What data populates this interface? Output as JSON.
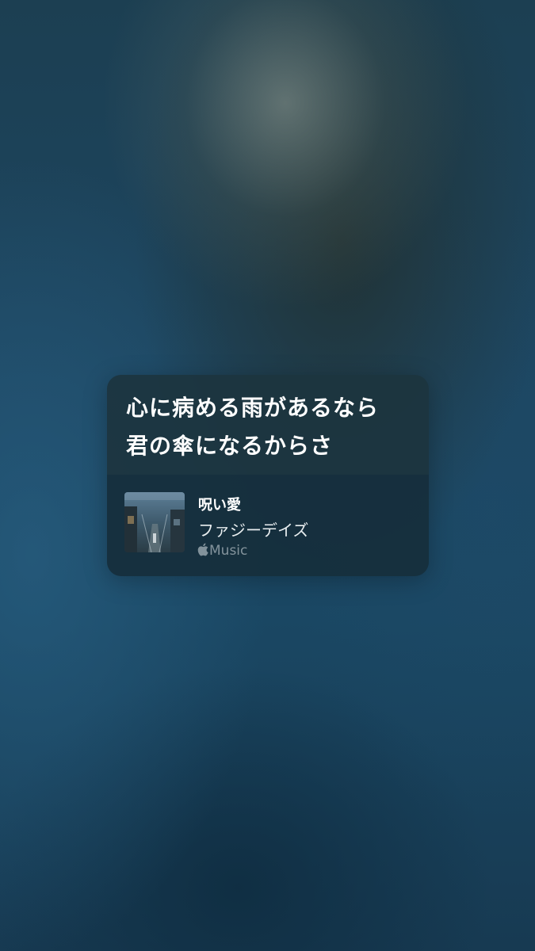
{
  "lyrics": {
    "line1": "心に病める雨があるなら",
    "line2": "君の傘になるからさ"
  },
  "track": {
    "title": "呪い愛",
    "artist": "ファジーデイズ",
    "artwork_icon": "album-artwork",
    "service": {
      "icon": "apple-logo-icon",
      "label": "Music"
    }
  },
  "colors": {
    "background": "#1d4661",
    "card": "#1c3440",
    "text": "#ffffff"
  }
}
